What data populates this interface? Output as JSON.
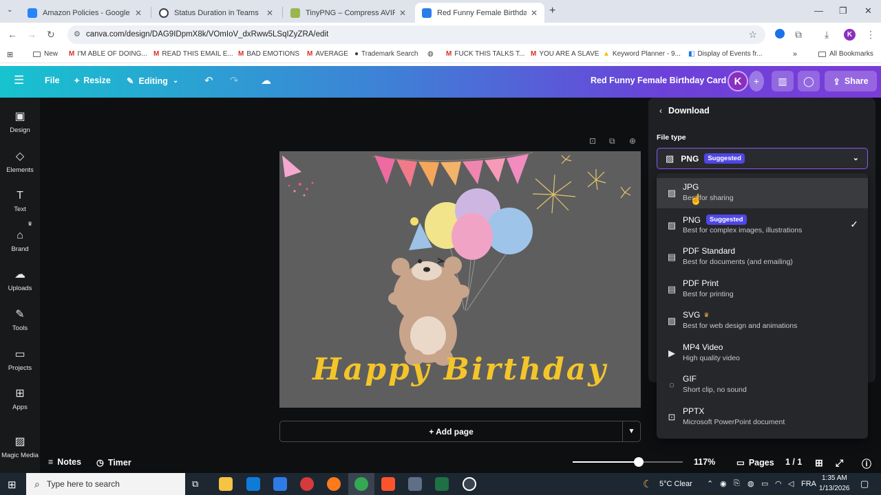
{
  "browser": {
    "tabs": [
      {
        "title": "Amazon Policies - Google Docs",
        "color": "#2684fc"
      },
      {
        "title": "Status Duration in Teams",
        "color": "#3c4043"
      },
      {
        "title": "TinyPNG – Compress AVIF, Web",
        "color": "#7b8a3a"
      },
      {
        "title": "Red Funny Female Birthday Car",
        "color": "#2b7de9"
      }
    ],
    "url": "canva.com/design/DAG9IDpmX8k/VOmIoV_dxRww5LSqIZyZRA/edit",
    "profile_initial": "K",
    "bookmarks": [
      {
        "label": "New",
        "type": "folder"
      },
      {
        "label": "I'M ABLE OF DOING...",
        "type": "gmail"
      },
      {
        "label": "READ THIS EMAIL E...",
        "type": "gmail"
      },
      {
        "label": "BAD EMOTIONS",
        "type": "gmail"
      },
      {
        "label": "AVERAGE",
        "type": "gmail"
      },
      {
        "label": "Trademark Search",
        "type": "site"
      },
      {
        "label": "",
        "type": "globe"
      },
      {
        "label": "FUCK THIS TALKS T...",
        "type": "gmail"
      },
      {
        "label": "YOU ARE A SLAVE",
        "type": "gmail"
      },
      {
        "label": "Keyword Planner - 9...",
        "type": "ads"
      },
      {
        "label": "Display of Events fr...",
        "type": "site"
      }
    ],
    "all_bookmarks": "All Bookmarks"
  },
  "editor": {
    "file": "File",
    "resize": "Resize",
    "editing": "Editing",
    "design_title": "Red Funny Female Birthday Card",
    "avatar": "K",
    "share": "Share"
  },
  "rail": [
    {
      "label": "Design",
      "icon": "design-icon"
    },
    {
      "label": "Elements",
      "icon": "elements-icon"
    },
    {
      "label": "Text",
      "icon": "text-icon"
    },
    {
      "label": "Brand",
      "icon": "brand-icon"
    },
    {
      "label": "Uploads",
      "icon": "uploads-icon"
    },
    {
      "label": "Tools",
      "icon": "tools-icon"
    },
    {
      "label": "Projects",
      "icon": "projects-icon"
    },
    {
      "label": "Apps",
      "icon": "apps-icon"
    },
    {
      "label": "Magic Media",
      "icon": "magic-media-icon"
    }
  ],
  "card": {
    "greeting": "Happy Birthday"
  },
  "canvas": {
    "add_page": "+ Add page"
  },
  "bottom": {
    "notes": "Notes",
    "timer": "Timer",
    "zoom": "117%",
    "zoom_level": 0.6,
    "pages": "Pages",
    "page_count": "1 / 1"
  },
  "download": {
    "title": "Download",
    "file_type_label": "File type",
    "selected": "PNG",
    "selected_badge": "Suggested",
    "options": [
      {
        "name": "JPG",
        "desc": "Best for sharing",
        "icon": "image-icon"
      },
      {
        "name": "PNG",
        "desc": "Best for complex images, illustrations",
        "badge": "Suggested",
        "icon": "image-icon",
        "checked": true
      },
      {
        "name": "PDF Standard",
        "desc": "Best for documents (and emailing)",
        "icon": "document-icon"
      },
      {
        "name": "PDF Print",
        "desc": "Best for printing",
        "icon": "document-icon"
      },
      {
        "name": "SVG",
        "desc": "Best for web design and animations",
        "icon": "image-icon",
        "pro": true
      },
      {
        "name": "MP4 Video",
        "desc": "High quality video",
        "icon": "video-icon"
      },
      {
        "name": "GIF",
        "desc": "Short clip, no sound",
        "icon": "gif-icon"
      },
      {
        "name": "PPTX",
        "desc": "Microsoft PowerPoint document",
        "icon": "presentation-icon"
      }
    ]
  },
  "taskbar": {
    "search_placeholder": "Type here to search",
    "weather": "5°C  Clear",
    "lang": "FRA",
    "time": "1:35 AM",
    "date": "1/13/2026"
  }
}
